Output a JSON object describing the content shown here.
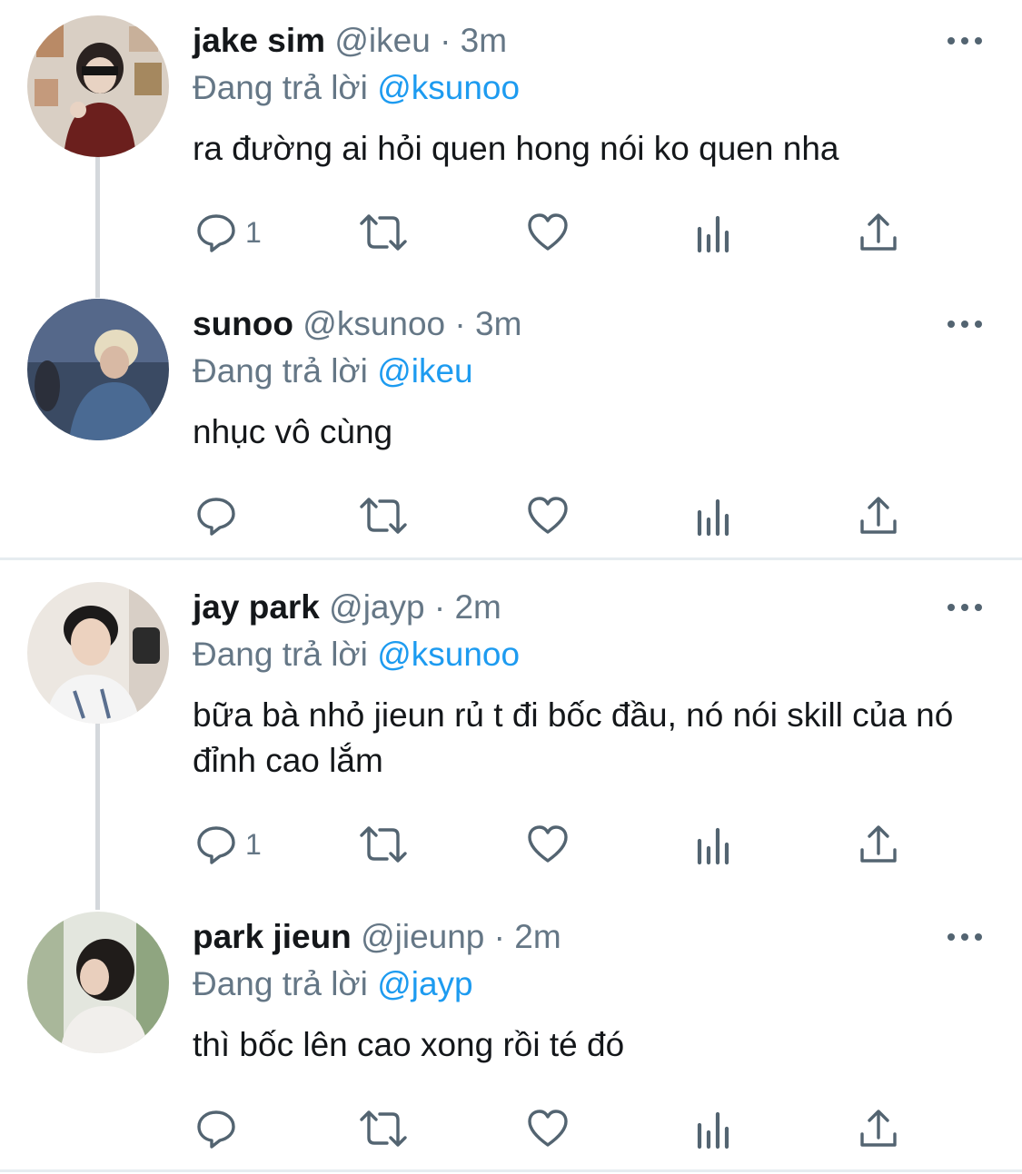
{
  "reply_prefix": "Đang trả lời",
  "tweets": [
    {
      "name": "jake sim",
      "handle": "@ikeu",
      "separator": "·",
      "time": "3m",
      "reply_to": "@ksunoo",
      "text": "ra đường ai hỏi quen hong nói ko quen nha",
      "reply_count": "1"
    },
    {
      "name": "sunoo",
      "handle": "@ksunoo",
      "separator": "·",
      "time": "3m",
      "reply_to": "@ikeu",
      "text": "nhục vô cùng",
      "reply_count": ""
    },
    {
      "name": "jay park",
      "handle": "@jayp",
      "separator": "·",
      "time": "2m",
      "reply_to": "@ksunoo",
      "text": "bữa bà nhỏ jieun rủ t đi bốc đầu, nó nói skill của nó đỉnh cao lắm",
      "reply_count": "1"
    },
    {
      "name": "park jieun",
      "handle": "@jieunp",
      "separator": "·",
      "time": "2m",
      "reply_to": "@jayp",
      "text": "thì bốc lên cao xong rồi té đó",
      "reply_count": ""
    }
  ],
  "icons": {
    "reply": "reply-icon",
    "retweet": "retweet-icon",
    "like": "heart-icon",
    "analytics": "analytics-icon",
    "share": "share-icon",
    "more": "more-options-icon"
  },
  "colors": {
    "mention": "#1d9bf0",
    "secondary_text": "#657786",
    "icon": "#536471",
    "thread_line": "#d4d8dc"
  }
}
